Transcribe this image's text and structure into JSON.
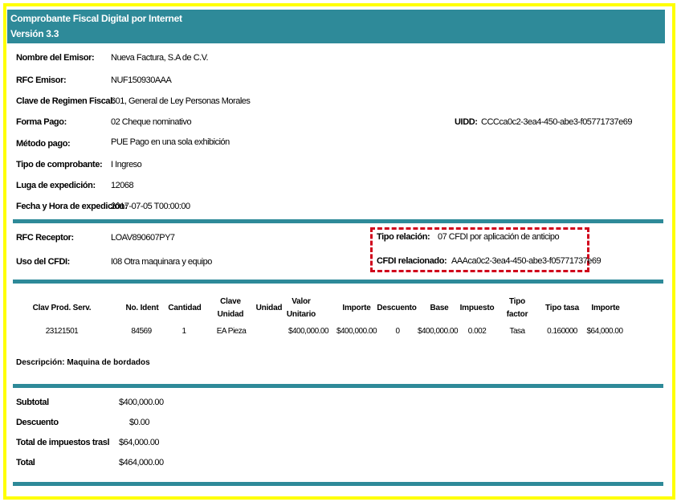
{
  "header": {
    "title": "Comprobante Fiscal Digital por Internet",
    "version": "Versión 3.3"
  },
  "emisor": [
    {
      "label": "Nombre del Emisor:",
      "value": "Nueva Factura, S.A de C.V."
    },
    {
      "label": "RFC Emisor:",
      "value": "NUF150930AAA"
    },
    {
      "label": "Clave de Regimen Fiscal:",
      "value": "601, General de Ley Personas Morales"
    },
    {
      "label": "Forma Pago:",
      "value": "02 Cheque nominativo"
    },
    {
      "label": "Método pago:",
      "value": "PUE Pago en una sola exhibición"
    },
    {
      "label": "Tipo de comprobante:",
      "value": "I Ingreso"
    },
    {
      "label": "Luga de expedición:",
      "value": "12068"
    },
    {
      "label": "Fecha y Hora de expedición:",
      "value": "2017-07-05 T00:00:00"
    }
  ],
  "uidd": {
    "label": "UIDD:",
    "value": "CCCca0c2-3ea4-450-abe3-f05771737e69"
  },
  "receptor": [
    {
      "label": "RFC Receptor:",
      "value": "LOAV890607PY7"
    },
    {
      "label": "Uso del CFDI:",
      "value": "I08 Otra maquinara y equipo"
    }
  ],
  "relacion": {
    "tipo_label": "Tipo relación:",
    "tipo_value": "07 CFDI por aplicación de anticipo",
    "cfdi_label": "CFDI relacionado:",
    "cfdi_value": "AAAca0c2-3ea4-450-abe3-f05771737e69"
  },
  "table": {
    "headers": [
      "Clav Prod. Serv.",
      "No. Ident",
      "Cantidad",
      "Clave Unidad",
      "Unidad",
      "Valor Unitario",
      "Importe",
      "Descuento",
      "Base",
      "Impuesto",
      "Tipo factor",
      "Tipo tasa",
      "Importe"
    ],
    "rows": [
      [
        "23121501",
        "84569",
        "1",
        "EA Pieza",
        "",
        "$400,000.00",
        "$400,000.00",
        "0",
        "$400,000.00",
        "0.002",
        "Tasa",
        "0.160000",
        "$64,000.00"
      ]
    ]
  },
  "descripcion": "Descripción: Maquina de bordados",
  "totales": [
    {
      "label": "Subtotal",
      "value": "$400,000.00"
    },
    {
      "label": "Descuento",
      "value": "$0.00"
    },
    {
      "label": "Total de impuestos traslada",
      "value": "$64,000.00"
    },
    {
      "label": "Total",
      "value": "$464,000.00"
    }
  ],
  "colors": {
    "accent": "#2e8a99",
    "frame": "#ffff00",
    "highlight": "#d0021b"
  }
}
